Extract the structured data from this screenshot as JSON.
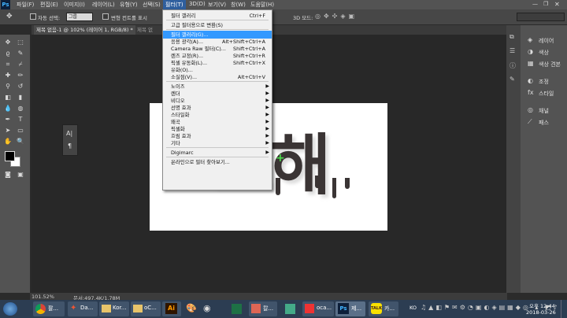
{
  "menubar": {
    "logo": "Ps",
    "items": [
      "파일(F)",
      "편집(E)",
      "이미지(I)",
      "레이어(L)",
      "유형(Y)",
      "선택(S)",
      "필터(T)",
      "3D(D)",
      "보기(V)",
      "창(W)",
      "도움말(H)"
    ],
    "active": "필터(T)"
  },
  "options": {
    "auto_select_label": "자동 선택:",
    "group_value": "그룹",
    "transform_label": "변형 컨트롤 표시",
    "mode_3d": "3D 모드:"
  },
  "tabs": {
    "active": "제목 없음-1 @ 102% (레이어 1, RGB/8) *",
    "second": "제목 없"
  },
  "filter_menu": {
    "items": [
      {
        "label": "필터 갤러리",
        "shortcut": "Ctrl+F"
      },
      {
        "sep": true
      },
      {
        "label": "고급 필터용으로 변환(S)",
        "shortcut": ""
      },
      {
        "sep": true
      },
      {
        "label": "필터 갤러리(G)...",
        "shortcut": "",
        "highlight": true
      },
      {
        "label": "응용 광각(A)...",
        "shortcut": "Alt+Shift+Ctrl+A"
      },
      {
        "label": "Camera Raw 필터(C)...",
        "shortcut": "Shift+Ctrl+A"
      },
      {
        "label": "렌즈 교정(R)...",
        "shortcut": "Shift+Ctrl+R"
      },
      {
        "label": "픽셀 유동화(L)...",
        "shortcut": "Shift+Ctrl+X"
      },
      {
        "label": "유화(O)...",
        "shortcut": ""
      },
      {
        "label": "소실점(V)...",
        "shortcut": "Alt+Ctrl+V"
      },
      {
        "sep": true
      },
      {
        "label": "노이즈",
        "submenu": true
      },
      {
        "label": "렌더",
        "submenu": true
      },
      {
        "label": "비디오",
        "submenu": true
      },
      {
        "label": "선명 효과",
        "submenu": true
      },
      {
        "label": "스타일화",
        "submenu": true
      },
      {
        "label": "왜곡",
        "submenu": true
      },
      {
        "label": "픽셀화",
        "submenu": true
      },
      {
        "label": "흐림 효과",
        "submenu": true
      },
      {
        "label": "기타",
        "submenu": true
      },
      {
        "sep": true
      },
      {
        "label": "Digimarc",
        "submenu": true
      },
      {
        "sep": true
      },
      {
        "label": "온라인으로 필터 찾아보기...",
        "shortcut": ""
      }
    ]
  },
  "canvas_text": "조해",
  "mini_panel": {
    "top": "A|",
    "bottom": "¶"
  },
  "right_panel": {
    "items": [
      "레이어",
      "색상",
      "색상 견본",
      "조정",
      "스타일",
      "채널",
      "패스"
    ]
  },
  "status": {
    "zoom": "101.52%",
    "doc": "문서:497.4K/1.78M"
  },
  "taskbar": {
    "apps": [
      "팔...",
      "Da...",
      "Kor...",
      "oC...",
      "Ai",
      "",
      "",
      "",
      "",
      "칼...",
      "",
      "oca...",
      "제...",
      "카...",
      "KO"
    ],
    "ime": "KO",
    "ampm": "오후 12:44",
    "date": "2018-03-26"
  },
  "colors": {
    "accent": "#3399ff",
    "ui_dark": "#535353",
    "canvas_bg": "#282828",
    "taskbar": "#2c3d52"
  }
}
